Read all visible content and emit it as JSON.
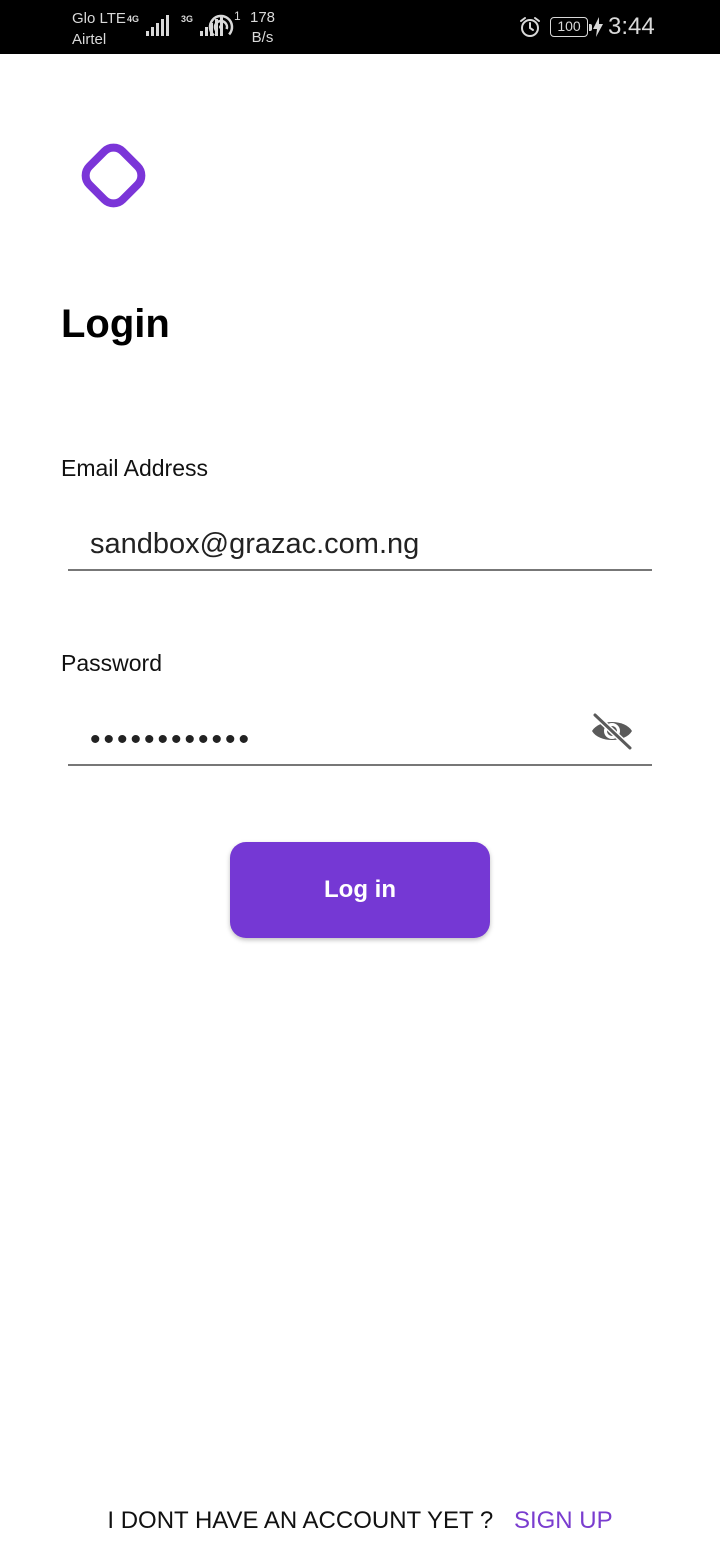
{
  "status_bar": {
    "carrier_primary": "Glo LTE",
    "carrier_secondary": "Airtel",
    "network_tag_1": "4G",
    "network_tag_2": "3G",
    "hotspot_count": "1",
    "speed_value": "178",
    "speed_unit": "B/s",
    "battery_level": "100",
    "time": "3:44",
    "icons": [
      "signal-icon",
      "hotspot-icon",
      "alarm-icon",
      "battery-icon",
      "charging-bolt-icon"
    ]
  },
  "logo": {
    "icon": "app-logo-icon",
    "color": "#7B35D8"
  },
  "page": {
    "title": "Login"
  },
  "form": {
    "email_label": "Email Address",
    "email_value": "sandbox@grazac.com.ng",
    "password_label": "Password",
    "password_value": "••••••••••••",
    "password_visibility_icon": "eye-off-icon",
    "submit_label": "Log in"
  },
  "footer": {
    "prompt_text": "I DONT HAVE AN ACCOUNT YET ?",
    "signup_label": "SIGN UP"
  },
  "colors": {
    "accent": "#7538D4",
    "link": "#7A3DCF",
    "status_bar_bg": "#000000"
  }
}
